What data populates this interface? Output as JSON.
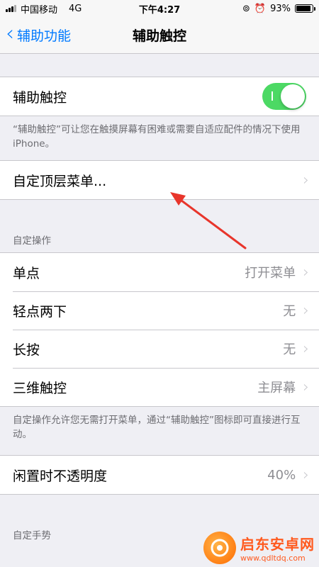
{
  "status_bar": {
    "carrier": "中国移动",
    "network": "4G",
    "time": "下午4:27",
    "battery_text": "93%",
    "battery_level": 0.93
  },
  "nav": {
    "back_label": "辅助功能",
    "title": "辅助触控"
  },
  "assistive_touch": {
    "label": "辅助触控",
    "enabled": true,
    "note": "“辅助触控”可让您在触摸屏幕有困难或需要自适应配件的情况下使用 iPhone。"
  },
  "top_menu": {
    "label": "自定顶层菜单..."
  },
  "custom_actions": {
    "header": "自定操作",
    "rows": [
      {
        "label": "单点",
        "value": "打开菜单"
      },
      {
        "label": "轻点两下",
        "value": "无"
      },
      {
        "label": "长按",
        "value": "无"
      },
      {
        "label": "三维触控",
        "value": "主屏幕"
      }
    ],
    "note": "自定操作允许您无需打开菜单，通过“辅助触控”图标即可直接进行互动。"
  },
  "idle_opacity": {
    "label": "闲置时不透明度",
    "value": "40%"
  },
  "custom_gestures": {
    "header": "自定手势"
  },
  "watermark": {
    "name": "启东安卓网",
    "url": "www.qdltdq.com"
  },
  "colors": {
    "accent": "#007aff",
    "toggle_on": "#4cd964",
    "annotation_arrow": "#e8352b"
  }
}
